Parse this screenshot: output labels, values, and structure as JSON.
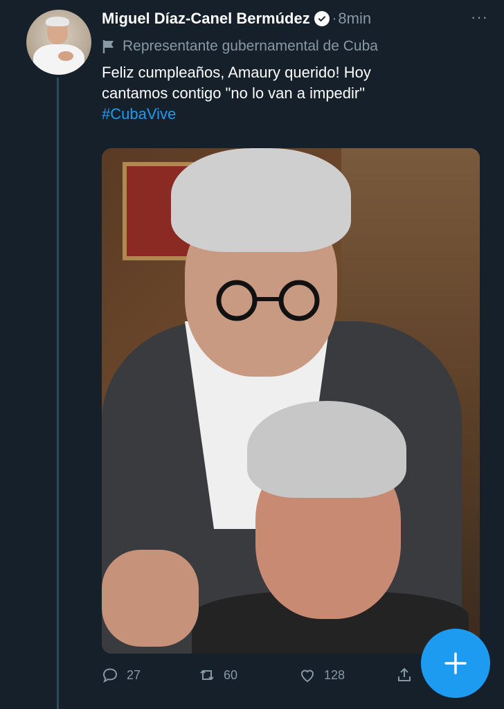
{
  "tweet": {
    "author_name": "Miguel Díaz-Canel Bermúdez",
    "separator": "·",
    "time": "8min",
    "more_label": "···",
    "account_label": "Representante gubernamental de Cuba",
    "text_line1": "Feliz cumpleaños, Amaury querido! Hoy",
    "text_line2": "cantamos contigo \"no lo van a impedir\"",
    "hashtag": "#CubaVive"
  },
  "actions": {
    "reply_count": "27",
    "retweet_count": "60",
    "like_count": "128"
  },
  "colors": {
    "background": "#15202b",
    "accent": "#1d9bf0",
    "muted": "#8899a6"
  },
  "icons": [
    "verified-badge-icon",
    "flag-icon",
    "more-icon",
    "reply-icon",
    "retweet-icon",
    "like-icon",
    "share-icon",
    "compose-plus-icon"
  ]
}
